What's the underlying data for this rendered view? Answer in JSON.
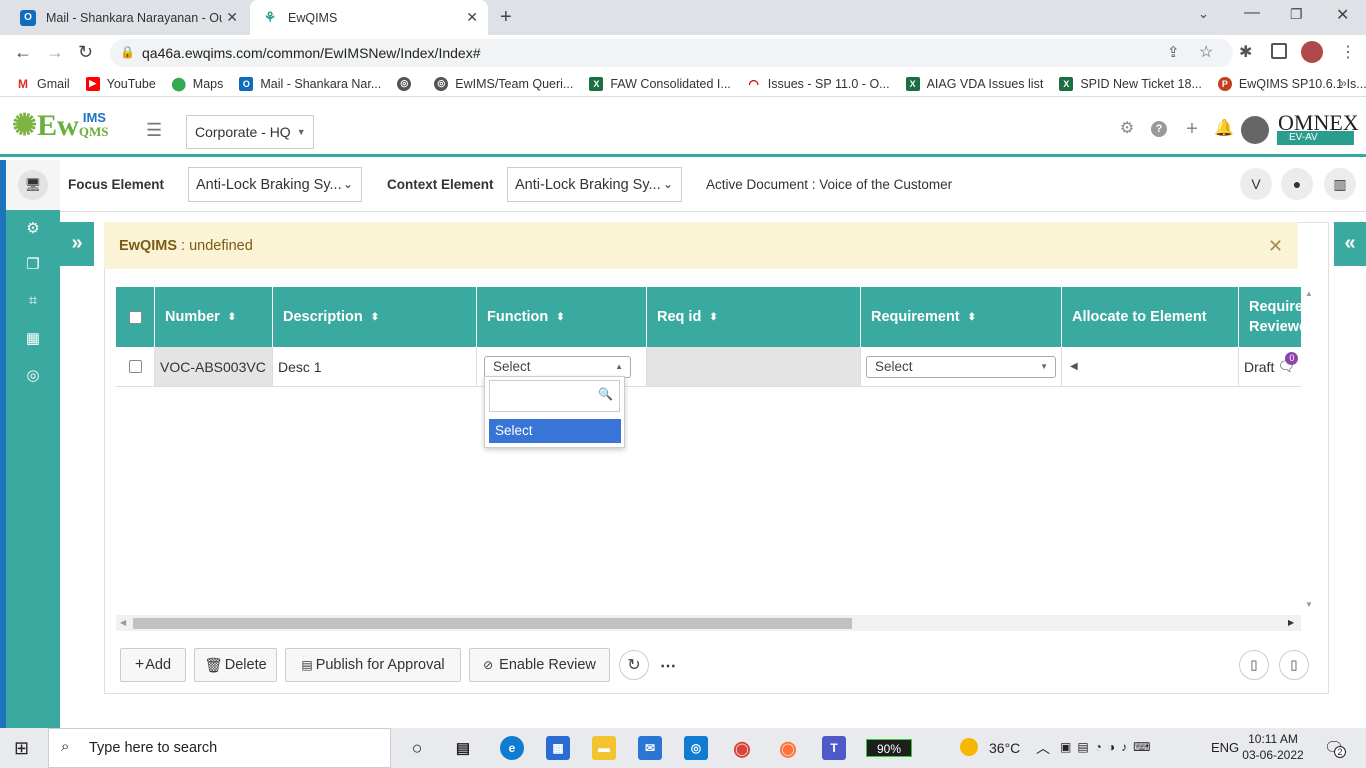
{
  "browser": {
    "tabs": [
      {
        "title": "Mail - Shankara Narayanan - Out",
        "icon": "outlook-icon"
      },
      {
        "title": "EwQIMS",
        "icon": "ewqims-icon"
      }
    ],
    "url": "qa46a.ewqims.com/common/EwIMSNew/Index/Index#",
    "bookmarks": [
      "Gmail",
      "YouTube",
      "Maps",
      "Mail - Shankara Nar...",
      "",
      "EwIMS/Team Queri...",
      "FAW Consolidated I...",
      "Issues - SP 11.0 - O...",
      "AIAG VDA Issues list",
      "SPID New Ticket 18...",
      "EwQIMS SP10.6.1 Is..."
    ]
  },
  "header": {
    "logo_main": "Ew",
    "logo_sub_top": "IMS",
    "logo_sub_bottom": "QMS",
    "entity": "Corporate - HQ",
    "brand": "OMNEX",
    "brand_sub": "EV-AV"
  },
  "context": {
    "focus_label": "Focus Element",
    "focus_value": "Anti-Lock Braking Sy...",
    "context_label": "Context Element",
    "context_value": "Anti-Lock Braking Sy...",
    "active_doc": "Active Document : Voice of the Customer"
  },
  "alert": {
    "app": "EwQIMS",
    "message": " : undefined"
  },
  "grid": {
    "columns": [
      "Number",
      "Description",
      "Function",
      "Req id",
      "Requirement",
      "Allocate to Element",
      "Require Reviewe"
    ],
    "rows": [
      {
        "number": "VOC-ABS003VC",
        "description": "Desc 1",
        "function": "Select",
        "req_id": "",
        "requirement": "Select",
        "allocate": "",
        "review": "Draft",
        "review_count": "0"
      }
    ],
    "dropdown_option": "Select"
  },
  "buttons": {
    "add": "Add",
    "delete": "Delete",
    "publish": "Publish for Approval",
    "enable_review": "Enable Review"
  },
  "taskbar": {
    "search_placeholder": "Type here to search",
    "battery": "90%",
    "temperature": "36°C",
    "lang": "ENG",
    "time": "10:11 AM",
    "date": "03-06-2022",
    "notifications": "2"
  },
  "colors": {
    "teal": "#3aa99f",
    "blue": "#1e73be",
    "alert_bg": "#fbf3d6",
    "select_highlight": "#3875d7"
  }
}
